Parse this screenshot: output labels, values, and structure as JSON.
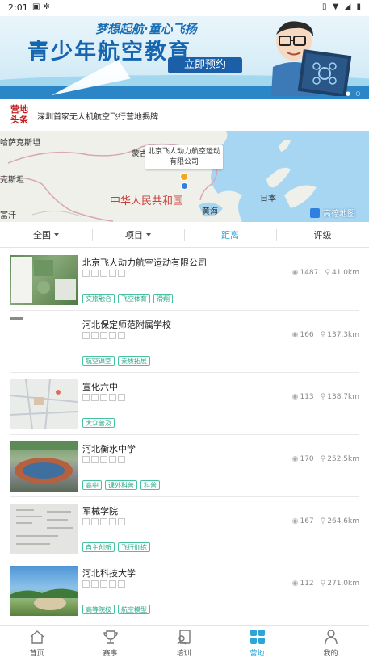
{
  "status_bar": {
    "time": "2:01",
    "left_icons": [
      "image-notification-icon",
      "bug-notification-icon"
    ],
    "right_icons": [
      "vibrate-icon",
      "wifi-icon",
      "signal-icon",
      "battery-icon"
    ]
  },
  "banner": {
    "slogan": "梦想起航·童心飞扬",
    "title": "青少年航空教育",
    "cta_label": "立即预约"
  },
  "news": {
    "logo_line1": "营地",
    "logo_line2": "头条",
    "text": "深圳首家无人机航空飞行营地揭牌"
  },
  "map": {
    "labels": {
      "kazakhstan": "哈萨克斯坦",
      "mongolia": "蒙古",
      "kyrgyzstan": "克斯坦",
      "china": "中华人民共和国",
      "japan": "日本",
      "yellow_sea": "黄海",
      "afghanistan": "富汗"
    },
    "callout_line1": "北京飞人动力航空运动",
    "callout_line2": "有限公司",
    "attribution": "高德地图"
  },
  "filters": {
    "tabs": [
      {
        "label": "全国",
        "has_caret": true,
        "active": false
      },
      {
        "label": "项目",
        "has_caret": true,
        "active": false
      },
      {
        "label": "距离",
        "has_caret": false,
        "active": true
      },
      {
        "label": "评级",
        "has_caret": false,
        "active": false
      }
    ]
  },
  "list": {
    "items": [
      {
        "name": "北京飞人动力航空运动有限公司",
        "views": "1487",
        "distance": "41.0km",
        "tags": [
          "文旅融合",
          "飞空体育",
          "滑翔"
        ]
      },
      {
        "name": "河北保定师范附属学校",
        "views": "166",
        "distance": "137.3km",
        "tags": [
          "航空课堂",
          "素质拓展"
        ]
      },
      {
        "name": "宣化六中",
        "views": "113",
        "distance": "138.7km",
        "tags": [
          "大众普及"
        ]
      },
      {
        "name": "河北衡水中学",
        "views": "170",
        "distance": "252.5km",
        "tags": [
          "高中",
          "课外科普",
          "科普"
        ]
      },
      {
        "name": "军械学院",
        "views": "167",
        "distance": "264.6km",
        "tags": [
          "自主创新",
          "飞行训练"
        ]
      },
      {
        "name": "河北科技大学",
        "views": "112",
        "distance": "271.0km",
        "tags": [
          "高等院校",
          "航空模型"
        ]
      }
    ]
  },
  "bottom_nav": {
    "items": [
      {
        "label": "首页",
        "icon": "home-icon",
        "active": false
      },
      {
        "label": "赛事",
        "icon": "trophy-icon",
        "active": false
      },
      {
        "label": "培训",
        "icon": "training-icon",
        "active": false
      },
      {
        "label": "营地",
        "icon": "camp-grid-icon",
        "active": true
      },
      {
        "label": "我的",
        "icon": "profile-icon",
        "active": false
      }
    ]
  },
  "colors": {
    "accent": "#2ea5d6",
    "tag_green": "#2bab87",
    "banner_blue": "#1565b0",
    "news_red": "#c21f1f"
  }
}
